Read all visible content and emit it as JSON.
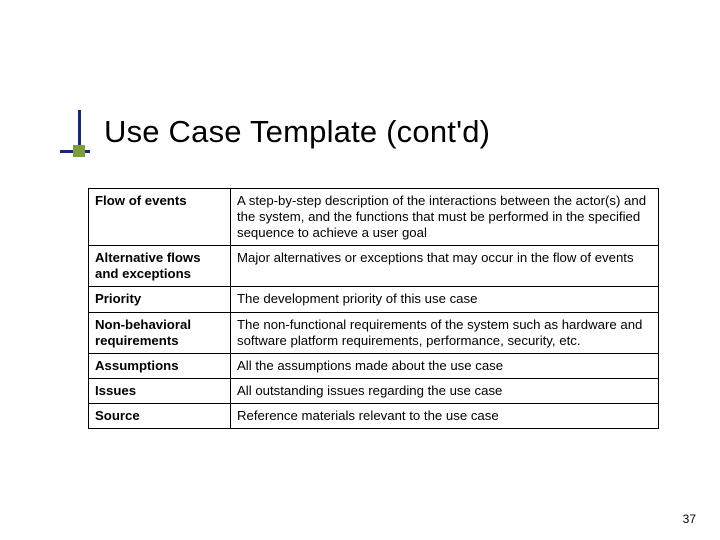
{
  "slide": {
    "title": "Use Case Template (cont'd)",
    "page_number": "37"
  },
  "rows": [
    {
      "label": "Flow of events",
      "desc": "A step-by-step description of the interactions between the actor(s) and the system, and the functions that must be performed in the specified sequence to achieve a user goal"
    },
    {
      "label": "Alternative flows and exceptions",
      "desc": "Major alternatives or exceptions that may occur in the flow of events"
    },
    {
      "label": "Priority",
      "desc": "The development priority of this use case"
    },
    {
      "label": "Non-behavioral requirements",
      "desc": "The non-functional requirements of the system such as hardware and software platform requirements, performance, security, etc."
    },
    {
      "label": "Assumptions",
      "desc": "All the assumptions made about the use case"
    },
    {
      "label": "Issues",
      "desc": "All outstanding issues regarding the use case"
    },
    {
      "label": "Source",
      "desc": "Reference materials relevant to the use case"
    }
  ]
}
